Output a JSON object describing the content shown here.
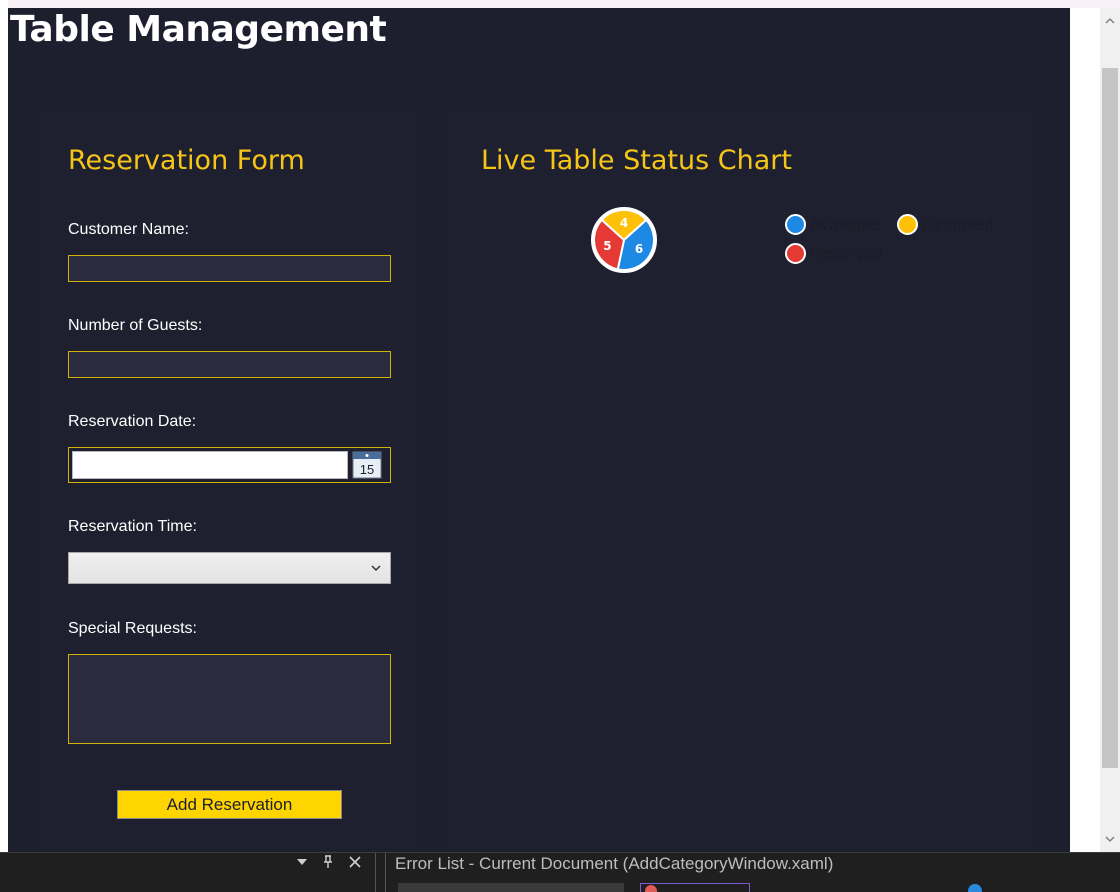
{
  "window": {
    "title": "Table Management"
  },
  "form": {
    "title": "Reservation Form",
    "customer_name_label": "Customer Name:",
    "customer_name_value": "",
    "guests_label": "Number of Guests:",
    "guests_value": "",
    "date_label": "Reservation Date:",
    "date_value": "",
    "date_icon_day": "15",
    "time_label": "Reservation Time:",
    "time_value": "",
    "requests_label": "Special Requests:",
    "requests_value": "",
    "submit_label": "Add Reservation"
  },
  "chart_panel": {
    "title": "Live Table Status Chart"
  },
  "chart_data": {
    "type": "pie",
    "slices": [
      {
        "name": "Available",
        "value": 6,
        "color": "#1e88e5"
      },
      {
        "name": "Occupied",
        "value": 4,
        "color": "#ffc107"
      },
      {
        "name": "Reserved",
        "value": 5,
        "color": "#e53935"
      }
    ],
    "legend_placement": "right"
  },
  "legend": {
    "available": "Available",
    "occupied": "Occupied",
    "reserved": "Reserved"
  },
  "colors": {
    "background": "#1e1f2e",
    "accent": "#f5c518",
    "button": "#ffd500",
    "available": "#1e88e5",
    "occupied": "#ffc107",
    "reserved": "#e53935"
  },
  "bottom_panel": {
    "title": "Error List - Current Document (AddCategoryWindow.xaml)",
    "controls": [
      "dropdown-icon",
      "pin-icon",
      "close-icon"
    ]
  }
}
